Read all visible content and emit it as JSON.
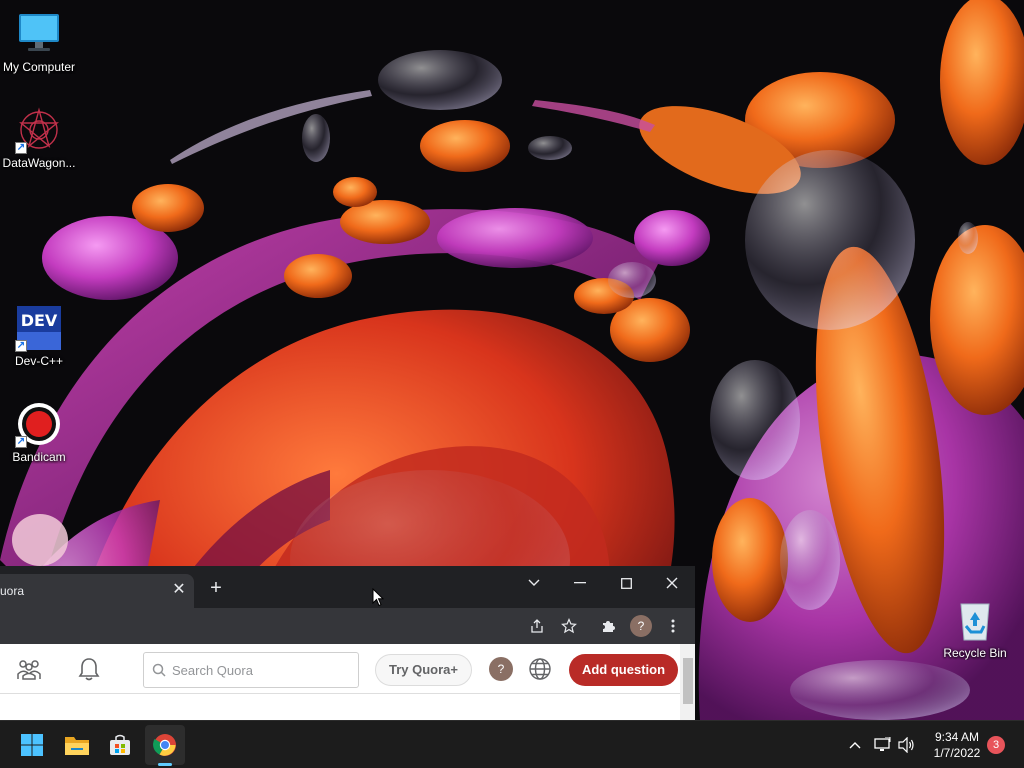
{
  "desktop": {
    "icons": [
      {
        "label": "My Computer",
        "icon": "monitor-icon"
      },
      {
        "label": "DataWagon...",
        "icon": "datawagon-icon"
      },
      {
        "label": "Dev-C++",
        "icon": "devcpp-icon",
        "glyph_text": "DEV"
      },
      {
        "label": "Bandicam",
        "icon": "bandicam-icon"
      },
      {
        "label": "Recycle Bin",
        "icon": "recycle-bin-icon"
      }
    ]
  },
  "browser": {
    "tab": {
      "title": "uora",
      "close_icon": "close-icon"
    },
    "new_tab_icon": "plus-icon",
    "window_controls": [
      "chevron-down-icon",
      "minimize-icon",
      "maximize-icon",
      "close-icon"
    ],
    "toolbar": {
      "icons": [
        "share-icon",
        "star-icon",
        "extensions-icon",
        "profile-avatar",
        "more-icon"
      ],
      "profile_initial": "?"
    },
    "quora": {
      "search_placeholder": "Search Quora",
      "try_label": "Try Quora+",
      "avatar_initial": "?",
      "add_question_label": "Add question"
    }
  },
  "taskbar": {
    "apps": [
      "start-icon",
      "file-explorer-icon",
      "store-icon",
      "chrome-icon"
    ],
    "tray_icons": [
      "chevron-up-icon",
      "network-icon",
      "volume-icon"
    ],
    "time": "9:34 AM",
    "date": "1/7/2022",
    "notification_count": "3"
  },
  "colors": {
    "accent": "#b92b27",
    "taskbar_bg": "#1c1c1c",
    "chrome_frame": "#202124",
    "chrome_toolbar": "#35363a"
  }
}
